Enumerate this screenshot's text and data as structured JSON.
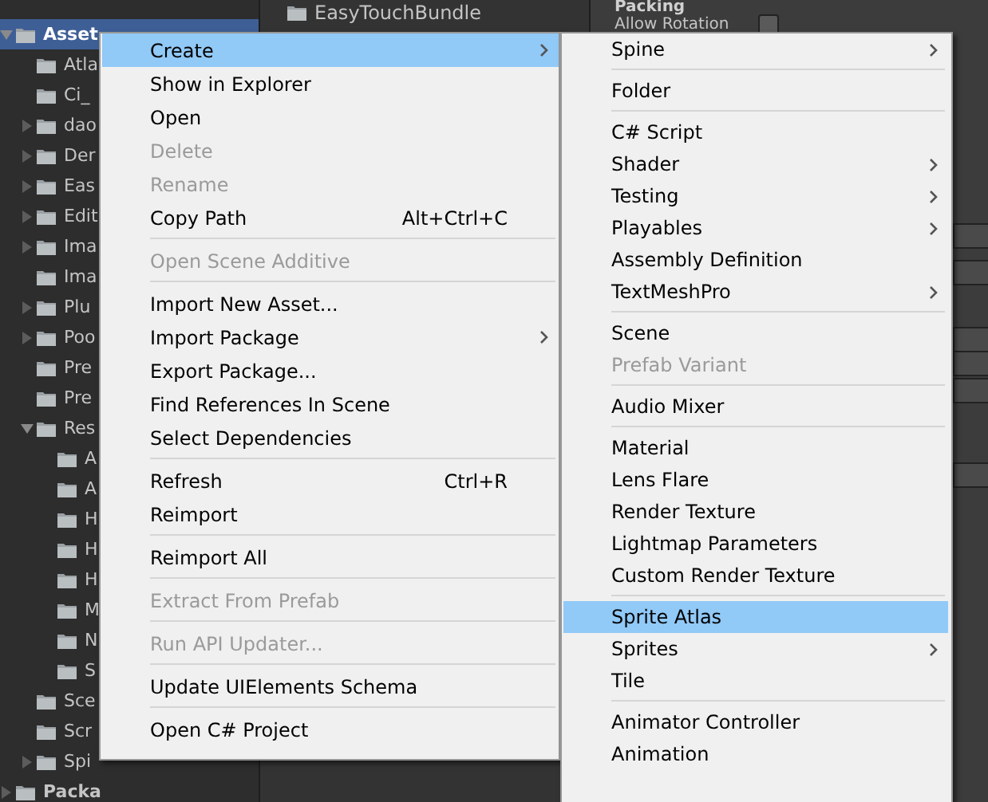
{
  "project_tree": [
    {
      "label": "Asset",
      "bold": true,
      "expanded": true,
      "selected": true,
      "children": [
        {
          "label": "Atla",
          "selected": false
        },
        {
          "label": "Ci_",
          "selected": false
        },
        {
          "label": "dao",
          "expanded": false,
          "selected": false
        },
        {
          "label": "Der",
          "expanded": false,
          "selected": false
        },
        {
          "label": "Eas",
          "expanded": false,
          "selected": false
        },
        {
          "label": "Edit",
          "expanded": false,
          "selected": false
        },
        {
          "label": "Ima",
          "expanded": false,
          "selected": false
        },
        {
          "label": "Ima",
          "selected": false
        },
        {
          "label": "Plu",
          "expanded": false,
          "selected": false
        },
        {
          "label": "Poo",
          "expanded": false,
          "selected": false
        },
        {
          "label": "Pre",
          "selected": false
        },
        {
          "label": "Pre",
          "selected": false
        },
        {
          "label": "Res",
          "expanded": true,
          "selected": false,
          "children": [
            {
              "label": "A",
              "selected": false
            },
            {
              "label": "A",
              "selected": false
            },
            {
              "label": "H",
              "selected": false
            },
            {
              "label": "H",
              "selected": false
            },
            {
              "label": "H",
              "selected": false
            },
            {
              "label": "M",
              "selected": false
            },
            {
              "label": "N",
              "selected": false
            },
            {
              "label": "S",
              "selected": false
            }
          ]
        },
        {
          "label": "Sce",
          "selected": false
        },
        {
          "label": "Scr",
          "selected": false
        },
        {
          "label": "Spi",
          "expanded": false,
          "selected": false
        }
      ]
    },
    {
      "label": "Packa",
      "bold": true,
      "expanded": false,
      "selected": false
    }
  ],
  "folder_list": {
    "label": "EasyTouchBundle"
  },
  "inspector": {
    "section": "Packing",
    "allow_rotation": {
      "label": "Allow Rotation",
      "checked": false
    }
  },
  "context_menu": [
    {
      "kind": "item",
      "label": "Create",
      "submenu": true,
      "disabled": false,
      "selected": true
    },
    {
      "kind": "item",
      "label": "Show in Explorer",
      "disabled": false,
      "selected": false
    },
    {
      "kind": "item",
      "label": "Open",
      "disabled": false,
      "selected": false
    },
    {
      "kind": "item",
      "label": "Delete",
      "disabled": true,
      "selected": false
    },
    {
      "kind": "item",
      "label": "Rename",
      "disabled": true,
      "selected": false
    },
    {
      "kind": "item",
      "label": "Copy Path",
      "shortcut": "Alt+Ctrl+C",
      "disabled": false,
      "selected": false
    },
    {
      "kind": "separator"
    },
    {
      "kind": "item",
      "label": "Open Scene Additive",
      "disabled": true,
      "selected": false
    },
    {
      "kind": "separator"
    },
    {
      "kind": "item",
      "label": "Import New Asset...",
      "disabled": false,
      "selected": false
    },
    {
      "kind": "item",
      "label": "Import Package",
      "submenu": true,
      "disabled": false,
      "selected": false
    },
    {
      "kind": "item",
      "label": "Export Package...",
      "disabled": false,
      "selected": false
    },
    {
      "kind": "item",
      "label": "Find References In Scene",
      "disabled": false,
      "selected": false
    },
    {
      "kind": "item",
      "label": "Select Dependencies",
      "disabled": false,
      "selected": false
    },
    {
      "kind": "separator"
    },
    {
      "kind": "item",
      "label": "Refresh",
      "shortcut": "Ctrl+R",
      "disabled": false,
      "selected": false
    },
    {
      "kind": "item",
      "label": "Reimport",
      "disabled": false,
      "selected": false
    },
    {
      "kind": "separator"
    },
    {
      "kind": "item",
      "label": "Reimport All",
      "disabled": false,
      "selected": false
    },
    {
      "kind": "separator"
    },
    {
      "kind": "item",
      "label": "Extract From Prefab",
      "disabled": true,
      "selected": false
    },
    {
      "kind": "separator"
    },
    {
      "kind": "item",
      "label": "Run API Updater...",
      "disabled": true,
      "selected": false
    },
    {
      "kind": "separator"
    },
    {
      "kind": "item",
      "label": "Update UIElements Schema",
      "disabled": false,
      "selected": false
    },
    {
      "kind": "separator"
    },
    {
      "kind": "item",
      "label": "Open C# Project",
      "disabled": false,
      "selected": false
    }
  ],
  "create_submenu": [
    {
      "kind": "item",
      "label": "Spine",
      "submenu": true,
      "disabled": false,
      "selected": false
    },
    {
      "kind": "separator"
    },
    {
      "kind": "item",
      "label": "Folder",
      "disabled": false,
      "selected": false
    },
    {
      "kind": "separator"
    },
    {
      "kind": "item",
      "label": "C# Script",
      "disabled": false,
      "selected": false
    },
    {
      "kind": "item",
      "label": "Shader",
      "submenu": true,
      "disabled": false,
      "selected": false
    },
    {
      "kind": "item",
      "label": "Testing",
      "submenu": true,
      "disabled": false,
      "selected": false
    },
    {
      "kind": "item",
      "label": "Playables",
      "submenu": true,
      "disabled": false,
      "selected": false
    },
    {
      "kind": "item",
      "label": "Assembly Definition",
      "disabled": false,
      "selected": false
    },
    {
      "kind": "item",
      "label": "TextMeshPro",
      "submenu": true,
      "disabled": false,
      "selected": false
    },
    {
      "kind": "separator"
    },
    {
      "kind": "item",
      "label": "Scene",
      "disabled": false,
      "selected": false
    },
    {
      "kind": "item",
      "label": "Prefab Variant",
      "disabled": true,
      "selected": false
    },
    {
      "kind": "separator"
    },
    {
      "kind": "item",
      "label": "Audio Mixer",
      "disabled": false,
      "selected": false
    },
    {
      "kind": "separator"
    },
    {
      "kind": "item",
      "label": "Material",
      "disabled": false,
      "selected": false
    },
    {
      "kind": "item",
      "label": "Lens Flare",
      "disabled": false,
      "selected": false
    },
    {
      "kind": "item",
      "label": "Render Texture",
      "disabled": false,
      "selected": false
    },
    {
      "kind": "item",
      "label": "Lightmap Parameters",
      "disabled": false,
      "selected": false
    },
    {
      "kind": "item",
      "label": "Custom Render Texture",
      "disabled": false,
      "selected": false
    },
    {
      "kind": "separator"
    },
    {
      "kind": "item",
      "label": "Sprite Atlas",
      "disabled": false,
      "selected": true
    },
    {
      "kind": "item",
      "label": "Sprites",
      "submenu": true,
      "disabled": false,
      "selected": false
    },
    {
      "kind": "item",
      "label": "Tile",
      "disabled": false,
      "selected": false
    },
    {
      "kind": "separator"
    },
    {
      "kind": "item",
      "label": "Animator Controller",
      "disabled": false,
      "selected": false
    },
    {
      "kind": "item",
      "label": "Animation",
      "disabled": false,
      "selected": false
    }
  ]
}
